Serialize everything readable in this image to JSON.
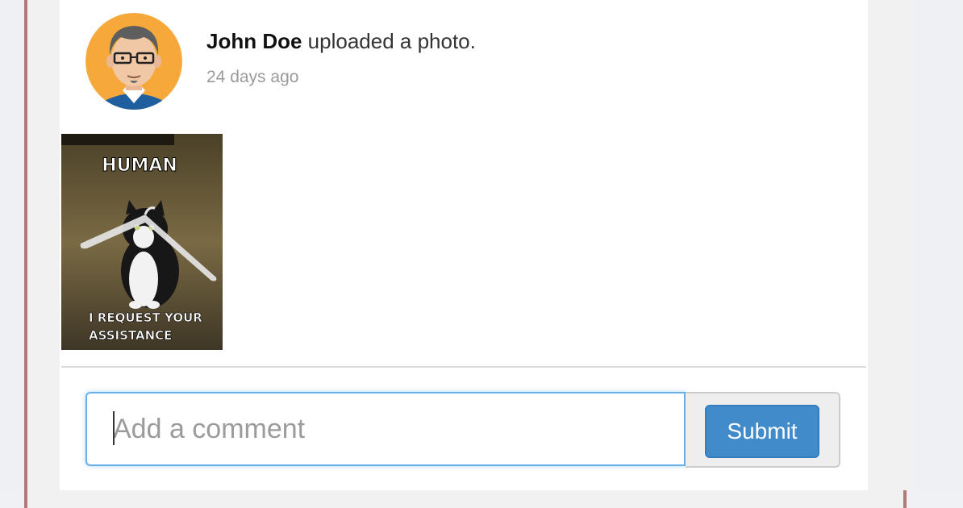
{
  "post": {
    "author": "John Doe",
    "action": " uploaded a photo.",
    "time": "24 days ago",
    "avatar_icon": "cartoon-man-avatar",
    "photo": {
      "top_text": "HUMAN",
      "bottom_text_line1": "I REQUEST YOUR",
      "bottom_text_line2": "ASSISTANCE"
    }
  },
  "comment": {
    "placeholder": "Add a comment",
    "value": "",
    "submit_label": "Submit"
  },
  "colors": {
    "accent": "#428bca",
    "frame_border": "#b47878",
    "focus_ring": "#66afe9"
  }
}
